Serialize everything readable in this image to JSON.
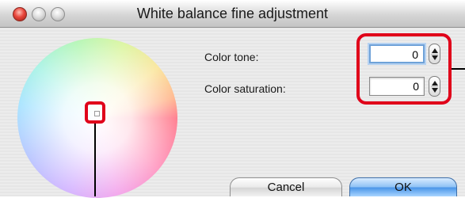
{
  "window": {
    "title": "White balance fine adjustment"
  },
  "form": {
    "color_tone": {
      "label": "Color tone:",
      "value": "0"
    },
    "color_saturation": {
      "label": "Color saturation:",
      "value": "0"
    }
  },
  "buttons": {
    "cancel": "Cancel",
    "ok": "OK"
  },
  "colors": {
    "highlight": "#e0001a",
    "ok_button": "#4a95e8",
    "focus_ring": "#6fa2d8"
  }
}
